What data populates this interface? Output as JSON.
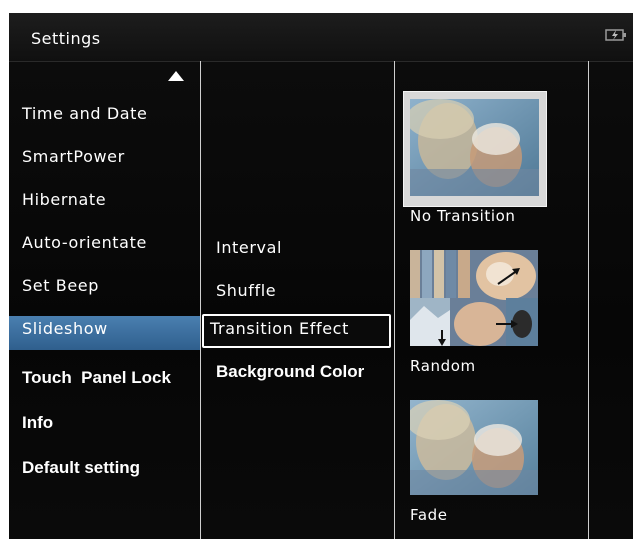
{
  "header": {
    "title": "Settings",
    "battery_icon": "battery-charging-icon"
  },
  "menu": {
    "items": [
      {
        "label": "Time and Date"
      },
      {
        "label": "SmartPower"
      },
      {
        "label": "Hibernate"
      },
      {
        "label": "Auto-orientate"
      },
      {
        "label": "Set Beep"
      },
      {
        "label": "Slideshow"
      },
      {
        "label": "Touch  Panel Lock"
      },
      {
        "label": "Info"
      },
      {
        "label": "Default setting"
      }
    ],
    "selected": "Slideshow",
    "selected_color": "#3a6d9d"
  },
  "submenu": {
    "items": [
      {
        "label": "Interval"
      },
      {
        "label": "Shuffle"
      },
      {
        "label": "Transition Effect"
      },
      {
        "label": "Background Color"
      }
    ],
    "focused": "Transition Effect"
  },
  "options": {
    "items": [
      {
        "label": "No Transition"
      },
      {
        "label": "Random"
      },
      {
        "label": "Fade"
      }
    ],
    "selected": "No Transition"
  }
}
